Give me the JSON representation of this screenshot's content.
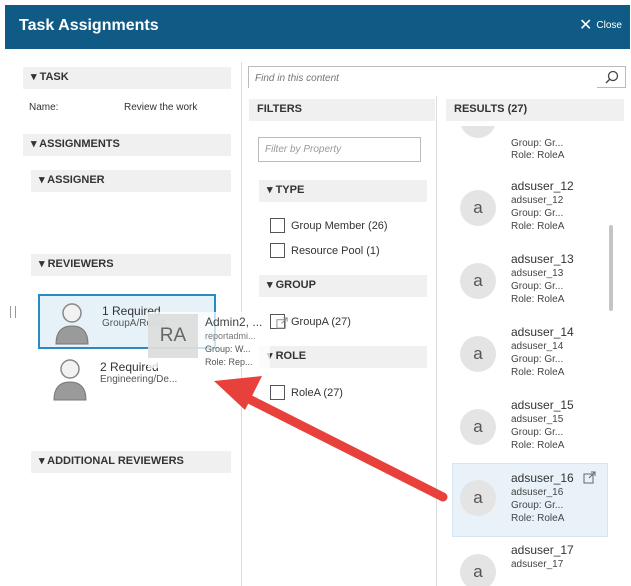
{
  "header": {
    "title": "Task Assignments",
    "close_label": "Close"
  },
  "task": {
    "section": "TASK",
    "name_label": "Name:",
    "name_value": "Review the work"
  },
  "assignments": {
    "section": "ASSIGNMENTS",
    "assigner": "ASSIGNER",
    "reviewers": "REVIEWERS",
    "reviewer_items": [
      {
        "name": "1 Required",
        "sub": "GroupA/RoleA"
      },
      {
        "name": "2 Required",
        "sub": "Engineering/De..."
      }
    ],
    "additional": "ADDITIONAL REVIEWERS"
  },
  "drag": {
    "initials": "RA",
    "name": "Admin2, ...",
    "sub": "reportadmi...",
    "group": "Group:  W...",
    "role": "Role:  Rep..."
  },
  "search": {
    "placeholder": "Find in this content"
  },
  "filters": {
    "title": "FILTERS",
    "placeholder": "Filter by Property",
    "type": {
      "label": "TYPE",
      "options": [
        "Group Member (26)",
        "Resource Pool (1)"
      ]
    },
    "group": {
      "label": "GROUP",
      "options": [
        "GroupA (27)"
      ]
    },
    "role": {
      "label": "ROLE",
      "options": [
        "RoleA (27)"
      ]
    }
  },
  "results": {
    "title": "RESULTS (27)",
    "partial": {
      "group": "Group:  Gr...",
      "role": "Role:  RoleA"
    },
    "items": [
      {
        "name": "adsuser_12",
        "id": "adsuser_12",
        "group": "Group:  Gr...",
        "role": "Role:  RoleA",
        "avatar": "a"
      },
      {
        "name": "adsuser_13",
        "id": "adsuser_13",
        "group": "Group:  Gr...",
        "role": "Role:  RoleA",
        "avatar": "a"
      },
      {
        "name": "adsuser_14",
        "id": "adsuser_14",
        "group": "Group:  Gr...",
        "role": "Role:  RoleA",
        "avatar": "a"
      },
      {
        "name": "adsuser_15",
        "id": "adsuser_15",
        "group": "Group:  Gr...",
        "role": "Role:  RoleA",
        "avatar": "a"
      },
      {
        "name": "adsuser_16",
        "id": "adsuser_16",
        "group": "Group:  Gr...",
        "role": "Role:  RoleA",
        "avatar": "a"
      },
      {
        "name": "adsuser_17",
        "id": "adsuser_17",
        "avatar": "a"
      }
    ]
  },
  "colors": {
    "header": "#0f5b86",
    "selected_border": "#2a8ac4",
    "selected_bg": "#e6f1f8",
    "arrow": "#e8403a"
  }
}
